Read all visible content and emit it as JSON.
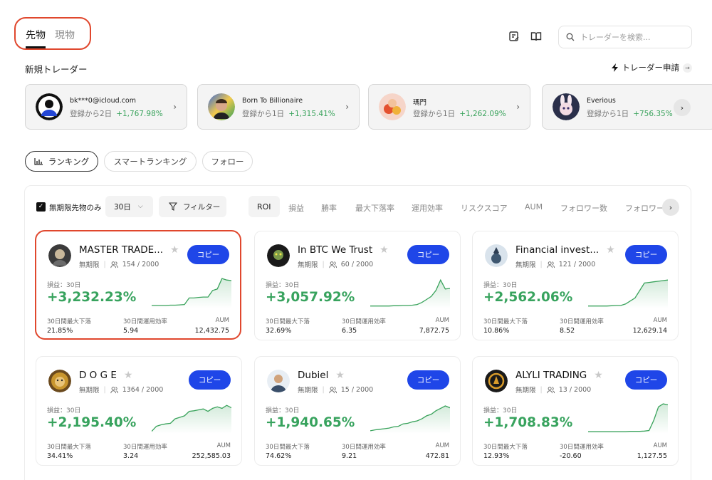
{
  "tabs": [
    {
      "label": "先物"
    },
    {
      "label": "現物"
    }
  ],
  "search": {
    "placeholder": "トレーダーを検索..."
  },
  "new_traders": {
    "title": "新規トレーダー",
    "apply_label": "トレーダー申請",
    "items": [
      {
        "name": "bk***0@icloud.com",
        "days": "登録から2日",
        "gain": "+1,767.98%"
      },
      {
        "name": "Born To Billionaire",
        "days": "登録から1日",
        "gain": "+1,315.41%"
      },
      {
        "name": "瑪門",
        "days": "登録から1日",
        "gain": "+1,262.09%"
      },
      {
        "name": "Everious",
        "days": "登録から1日",
        "gain": "+756.35%"
      }
    ]
  },
  "sub_tabs": [
    {
      "label": "ランキング"
    },
    {
      "label": "スマートランキング"
    },
    {
      "label": "フォロー"
    }
  ],
  "filters": {
    "perpetual_label": "無期限先物のみ",
    "period": "30日",
    "filter_label": "フィルター",
    "sort_options": [
      "ROI",
      "損益",
      "勝率",
      "最大下落率",
      "運用効率",
      "リスクスコア",
      "AUM",
      "フォロワー数",
      "フォロワー"
    ]
  },
  "card_labels": {
    "type": "無期限",
    "copy": "コピー",
    "pnl_label": "損益：30日",
    "max_dd": "30日間最大下落",
    "efficiency": "30日間運用効率",
    "aum": "AUM"
  },
  "cards": [
    {
      "name": "MASTER TRADE...",
      "followers": "154 / 2000",
      "pnl": "+3,232.23%",
      "max_dd": "21.85%",
      "efficiency": "5.94",
      "aum": "12,432.75",
      "spark": [
        0.05,
        0.05,
        0.05,
        0.05,
        0.06,
        0.06,
        0.07,
        0.08,
        0.3,
        0.3,
        0.32,
        0.33,
        0.33,
        0.55,
        0.6,
        0.95,
        0.9,
        0.88
      ]
    },
    {
      "name": "In BTC We Trust",
      "followers": "60 / 2000",
      "pnl": "+3,057.92%",
      "max_dd": "32.69%",
      "efficiency": "6.35",
      "aum": "7,872.75",
      "spark": [
        0.03,
        0.03,
        0.03,
        0.03,
        0.03,
        0.04,
        0.04,
        0.05,
        0.05,
        0.06,
        0.08,
        0.15,
        0.25,
        0.35,
        0.55,
        0.9,
        0.6,
        0.62
      ]
    },
    {
      "name": "Financial invest...",
      "followers": "121 / 2000",
      "pnl": "+2,562.06%",
      "max_dd": "10.86%",
      "efficiency": "8.52",
      "aum": "12,629.14",
      "spark": [
        0.03,
        0.03,
        0.03,
        0.03,
        0.03,
        0.04,
        0.05,
        0.05,
        0.1,
        0.2,
        0.3,
        0.55,
        0.8,
        0.82,
        0.84,
        0.86,
        0.88,
        0.9
      ]
    },
    {
      "name": "D O G E",
      "followers": "1364 / 2000",
      "pnl": "+2,195.40%",
      "max_dd": "34.41%",
      "efficiency": "3.24",
      "aum": "252,585.03",
      "spark": [
        0.03,
        0.2,
        0.25,
        0.28,
        0.3,
        0.45,
        0.5,
        0.55,
        0.7,
        0.72,
        0.75,
        0.78,
        0.7,
        0.8,
        0.85,
        0.8,
        0.9,
        0.82
      ]
    },
    {
      "name": "Dubiel",
      "followers": "15 / 2000",
      "pnl": "+1,940.65%",
      "max_dd": "74.62%",
      "efficiency": "9.21",
      "aum": "472.81",
      "spark": [
        0.05,
        0.08,
        0.1,
        0.12,
        0.14,
        0.18,
        0.2,
        0.28,
        0.3,
        0.35,
        0.38,
        0.45,
        0.55,
        0.6,
        0.72,
        0.8,
        0.88,
        0.82
      ]
    },
    {
      "name": "ALYLI TRADING",
      "followers": "13 / 2000",
      "pnl": "+1,708.83%",
      "max_dd": "12.93%",
      "efficiency": "-20.60",
      "aum": "1,127.55",
      "spark": [
        0.02,
        0.02,
        0.02,
        0.02,
        0.02,
        0.02,
        0.02,
        0.02,
        0.02,
        0.03,
        0.03,
        0.03,
        0.04,
        0.06,
        0.4,
        0.85,
        0.95,
        0.92
      ]
    }
  ]
}
